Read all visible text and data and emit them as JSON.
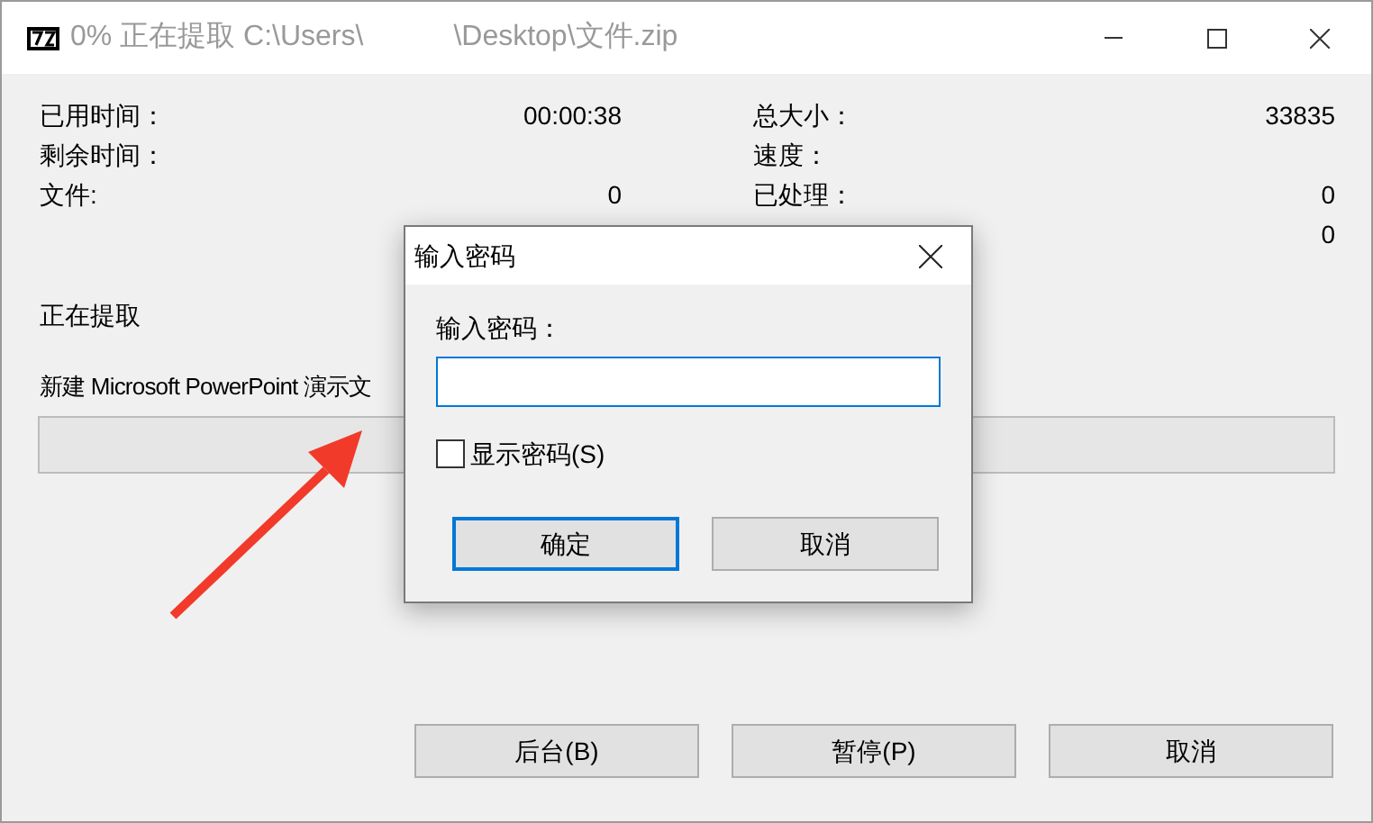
{
  "window": {
    "title_start": "0% 正在提取 C:\\Users\\",
    "title_end": "\\Desktop\\文件.zip"
  },
  "stats_left": [
    {
      "label": "已用时间：",
      "value": "00:00:38"
    },
    {
      "label": "剩余时间："
    },
    {
      "label": "文件:",
      "value": "0"
    }
  ],
  "stats_right": [
    {
      "label": "总大小：",
      "value": "33835"
    },
    {
      "label": "速度："
    },
    {
      "label": "已处理：",
      "value": "0"
    },
    {
      "value": "0"
    }
  ],
  "status": "正在提取",
  "file": "新建 Microsoft PowerPoint 演示文",
  "progress": {
    "level": 0
  },
  "buttons": [
    "后台(B)",
    "暂停(P)",
    "取消"
  ],
  "dialog": {
    "title": "输入密码",
    "label": "输入密码：",
    "checkbox": {
      "label": "显示密码(S)",
      "checked": false
    },
    "buttons": [
      {
        "label": "确定",
        "default": true
      },
      {
        "label": "取消",
        "default": false
      }
    ]
  }
}
